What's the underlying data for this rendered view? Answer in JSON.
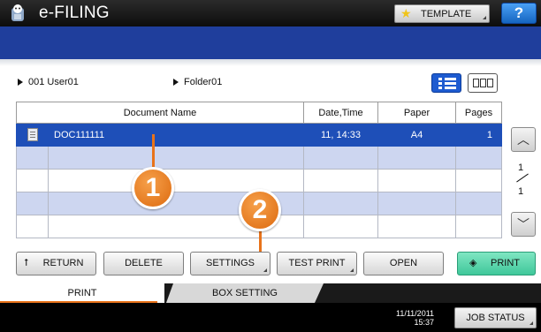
{
  "app": {
    "title": "e-FILING",
    "icon": "efiling-mascot-icon"
  },
  "header": {
    "template_label": "TEMPLATE",
    "help_label": "?"
  },
  "breadcrumb": {
    "user": "001 User01",
    "folder": "Folder01"
  },
  "table": {
    "columns": [
      "Document Name",
      "Date,Time",
      "Paper",
      "Pages"
    ],
    "rows": [
      {
        "name": "DOC111111",
        "datetime": "11, 14:33",
        "paper": "A4",
        "pages": "1",
        "selected": true
      }
    ]
  },
  "pager": {
    "current": "1",
    "total": "1"
  },
  "callouts": [
    "1",
    "2"
  ],
  "actions": {
    "return": "RETURN",
    "delete": "DELETE",
    "settings": "SETTINGS",
    "test_print": "TEST PRINT",
    "open": "OPEN",
    "print": "PRINT"
  },
  "tabs": {
    "print": "PRINT",
    "box_setting": "BOX SETTING"
  },
  "status": {
    "date": "11/11/2011",
    "time": "15:37",
    "job_status": "JOB STATUS"
  },
  "colors": {
    "title_bar": "#1a1a1a",
    "accent_blue": "#1f3e9c",
    "selected_row": "#1e4fb8",
    "alt_row": "#cdd6f0",
    "print_button": "#3fc79a",
    "callout": "#e8731a"
  }
}
